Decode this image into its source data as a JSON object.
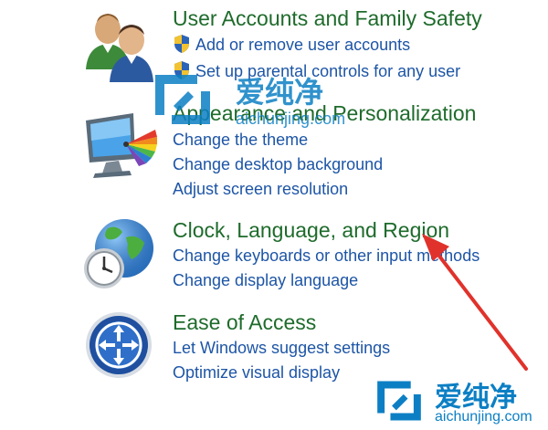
{
  "categories": [
    {
      "title": "User Accounts and Family Safety",
      "icon": "users-icon",
      "tasks": [
        {
          "label": "Add or remove user accounts",
          "shield": true
        },
        {
          "label": "Set up parental controls for any user",
          "shield": true
        }
      ]
    },
    {
      "title": "Appearance and Personalization",
      "icon": "monitor-palette-icon",
      "tasks": [
        {
          "label": "Change the theme",
          "shield": false
        },
        {
          "label": "Change desktop background",
          "shield": false
        },
        {
          "label": "Adjust screen resolution",
          "shield": false
        }
      ]
    },
    {
      "title": "Clock, Language, and Region",
      "icon": "globe-clock-icon",
      "tasks": [
        {
          "label": "Change keyboards or other input methods",
          "shield": false
        },
        {
          "label": "Change display language",
          "shield": false
        }
      ]
    },
    {
      "title": "Ease of Access",
      "icon": "ease-of-access-icon",
      "tasks": [
        {
          "label": "Let Windows suggest settings",
          "shield": false
        },
        {
          "label": "Optimize visual display",
          "shield": false
        }
      ]
    }
  ],
  "watermark": {
    "brand_cn": "爱纯净",
    "url": "aichunjing.com"
  },
  "colors": {
    "title_green": "#1e6b2b",
    "link_blue": "#1d55a6",
    "arrow_red": "#e0322b",
    "watermark_blue": "#0c7fc4"
  }
}
